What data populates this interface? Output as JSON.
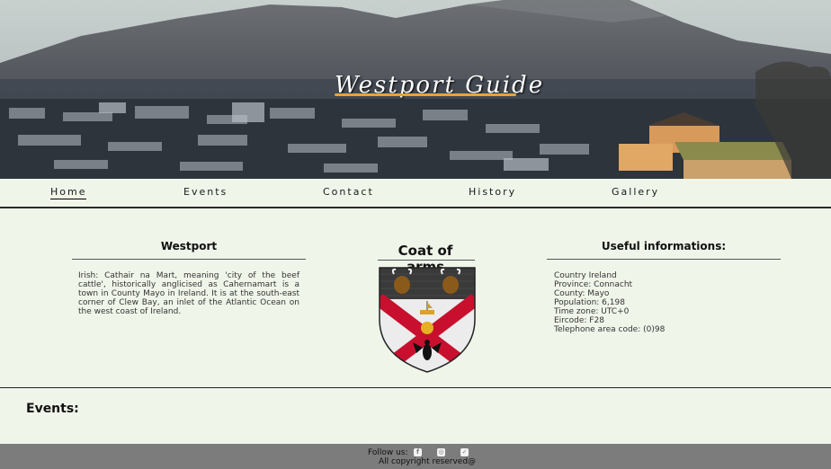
{
  "hero": {
    "title": "Westport Guide"
  },
  "nav": {
    "items": [
      "Home",
      "Events",
      "Contact",
      "History",
      "Gallery"
    ],
    "active": "Home"
  },
  "about": {
    "title": "Westport",
    "text": "Irish: Cathair na Mart, meaning 'city of the beef cattle', historically anglicised as Cahernamart is a town in County Mayo in Ireland. It is at the south-east corner of Clew Bay, an inlet of the Atlantic Ocean on the west coast of Ireland."
  },
  "coat": {
    "title": "Coat of arms"
  },
  "info": {
    "title": "Useful informations:",
    "items": [
      "Country Ireland",
      "Province: Connacht",
      "County: Mayo",
      "Population: 6,198",
      "Time zone: UTC+0",
      "Eircode: F28",
      "Telephone area code: (0)98"
    ]
  },
  "events": {
    "heading": "Events:"
  },
  "footer": {
    "follow_label": "Follow us:",
    "social_icons": [
      "facebook-icon",
      "instagram-icon",
      "twitter-icon"
    ],
    "copyright": "All copyright reserved@"
  },
  "colors": {
    "page_bg": "#f0f5ea",
    "footer_bg": "#7c7c7c",
    "title_underline": "#e2a63b",
    "shield_red": "#c8102e"
  }
}
